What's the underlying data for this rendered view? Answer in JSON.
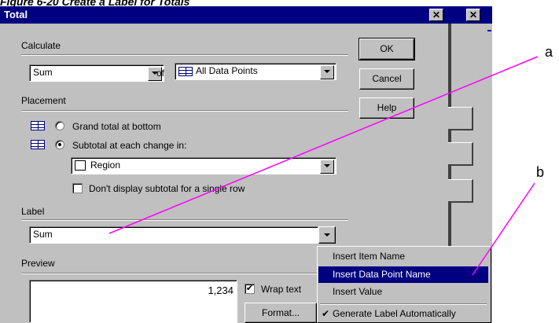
{
  "caption": "Figure 6-20 Create a Label for Totals",
  "dialog": {
    "title": "Total",
    "close_glyph": "✕"
  },
  "calculate": {
    "label": "Calculate",
    "function_value": "Sum",
    "of_label": "of",
    "target_value": "All Data Points"
  },
  "buttons": {
    "ok": "OK",
    "cancel": "Cancel",
    "help": "Help"
  },
  "placement": {
    "label": "Placement",
    "grand_total": "Grand total at bottom",
    "subtotal": "Subtotal at each change in:",
    "selected": "subtotal",
    "break_value": "Region",
    "single_row": "Don't display subtotal for a single row",
    "single_row_checked": false
  },
  "label_section": {
    "label": "Label",
    "value": "Sum"
  },
  "preview": {
    "label": "Preview",
    "value": "1,234",
    "wrap_text": "Wrap text",
    "wrap_checked": true,
    "format_button": "Format..."
  },
  "label_menu": {
    "items": [
      "Insert Item Name",
      "Insert Data Point Name",
      "Insert Value",
      "Generate Label Automatically"
    ],
    "highlighted_index": 1,
    "checked_index": 3,
    "check_glyph": "✔"
  },
  "callouts": {
    "a": "a",
    "b": "b"
  },
  "colors": {
    "titlebar": "#000080",
    "face": "#c0c0c0",
    "callout_line": "#ff00ff"
  }
}
